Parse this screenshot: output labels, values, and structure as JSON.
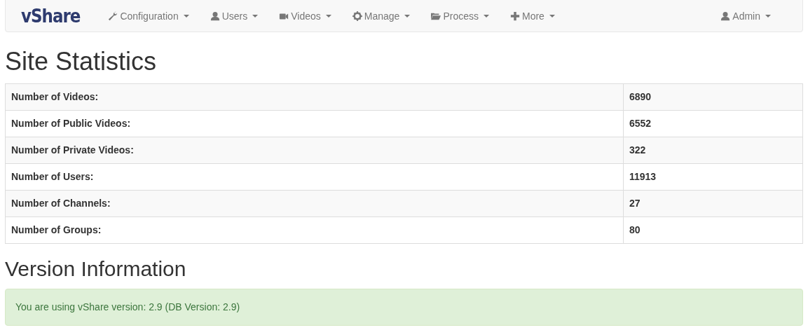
{
  "navbar": {
    "brand": "vShare",
    "menus": [
      {
        "label": "Configuration",
        "kind": "wrench"
      },
      {
        "label": "Users",
        "kind": "user"
      },
      {
        "label": "Videos",
        "kind": "camera"
      },
      {
        "label": "Manage",
        "kind": "gear"
      },
      {
        "label": "Process",
        "kind": "folder"
      },
      {
        "label": "More",
        "kind": "plus"
      }
    ],
    "user_menu": {
      "label": "Admin",
      "kind": "user"
    }
  },
  "statistics": {
    "title": "Site Statistics",
    "rows": [
      {
        "label": "Number of Videos:",
        "value": "6890"
      },
      {
        "label": "Number of Public Videos:",
        "value": "6552"
      },
      {
        "label": "Number of Private Videos:",
        "value": "322"
      },
      {
        "label": "Number of Users:",
        "value": "11913"
      },
      {
        "label": "Number of Channels:",
        "value": "27"
      },
      {
        "label": "Number of Groups:",
        "value": "80"
      }
    ]
  },
  "version": {
    "title": "Version Information",
    "message": "You are using vShare version: 2.9 (DB Version: 2.9)"
  }
}
